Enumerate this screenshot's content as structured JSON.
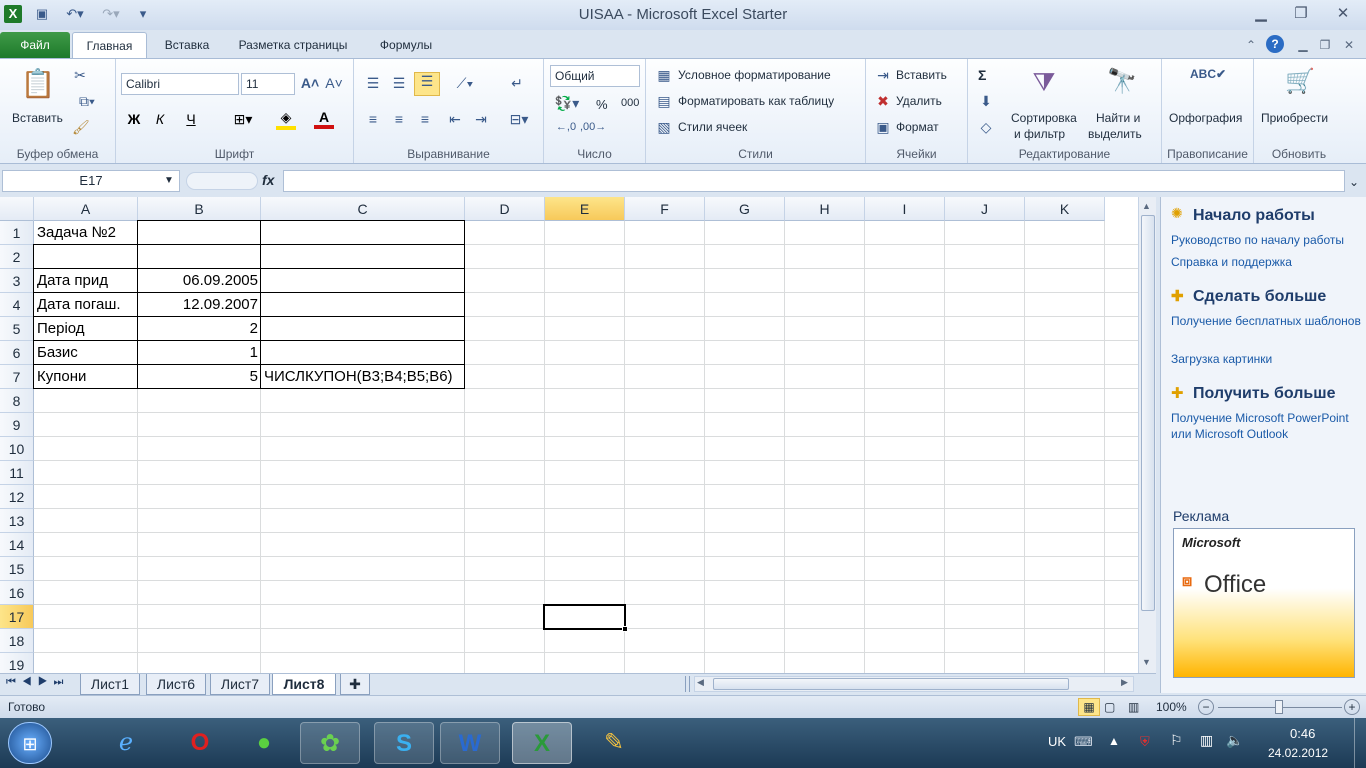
{
  "window": {
    "title": "UISAA  -  Microsoft Excel Starter"
  },
  "ribbon_tabs": [
    "Файл",
    "Главная",
    "Вставка",
    "Разметка страницы",
    "Формулы"
  ],
  "ribbon": {
    "clipboard": {
      "paste": "Вставить",
      "label": "Буфер обмена"
    },
    "font": {
      "name": "Calibri",
      "size": "11",
      "bold": "Ж",
      "italic": "К",
      "underline": "Ч",
      "label": "Шрифт"
    },
    "alignment": {
      "label": "Выравнивание"
    },
    "number": {
      "format": "Общий",
      "percent": "%",
      "thousands": "000",
      "label": "Число"
    },
    "styles": {
      "cond": "Условное форматирование",
      "table": "Форматировать как таблицу",
      "cell": "Стили ячеек",
      "label": "Стили"
    },
    "cells": {
      "insert": "Вставить",
      "delete": "Удалить",
      "format": "Формат",
      "label": "Ячейки"
    },
    "editing": {
      "sum": "Σ",
      "sort1": "Сортировка",
      "sort2": "и фильтр",
      "find1": "Найти и",
      "find2": "выделить",
      "label": "Редактирование"
    },
    "proofing": {
      "spell": "Орфография",
      "label": "Правописание"
    },
    "update": {
      "purchase": "Приобрести",
      "label": "Обновить"
    }
  },
  "formula_bar": {
    "name_box": "E17",
    "fx": "fx",
    "content": ""
  },
  "columns": [
    "A",
    "B",
    "C",
    "D",
    "E",
    "F",
    "G",
    "H",
    "I",
    "J",
    "K"
  ],
  "rows": [
    "1",
    "2",
    "3",
    "4",
    "5",
    "6",
    "7",
    "8",
    "9",
    "10",
    "11",
    "12",
    "13",
    "14",
    "15",
    "16",
    "17",
    "18",
    "19"
  ],
  "cells": {
    "A1": "Задача №2",
    "A3": "Дата прид",
    "A4": "Дата погаш.",
    "A5": "Період",
    "A6": "Базис",
    "A7": "Купони",
    "B3": "06.09.2005",
    "B4": "12.09.2007",
    "B5": "2",
    "B6": "1",
    "B7": "5",
    "C7": "ЧИСЛКУПОН(B3;B4;B5;B6)"
  },
  "sheet_tabs": [
    "Лист1",
    "Лист6",
    "Лист7",
    "Лист8"
  ],
  "active_sheet": "Лист8",
  "side_pane": {
    "start": "Начало работы",
    "start_links": [
      "Руководство по началу работы",
      "Справка и поддержка"
    ],
    "more": "Сделать больше",
    "more_links": [
      "Получение бесплатных шаблонов",
      "Загрузка картинки"
    ],
    "get": "Получить больше",
    "get_links": [
      "Получение Microsoft PowerPoint или Microsoft Outlook"
    ],
    "ad": "Реклама",
    "ad_brand": "Microsoft",
    "ad_product": "Office"
  },
  "status": {
    "ready": "Готово",
    "zoom": "100%"
  },
  "taskbar": {
    "lang": "UK",
    "time": "0:46",
    "date": "24.02.2012"
  },
  "colors": {
    "accent": "#1e7a2a",
    "selection": "#000000"
  }
}
